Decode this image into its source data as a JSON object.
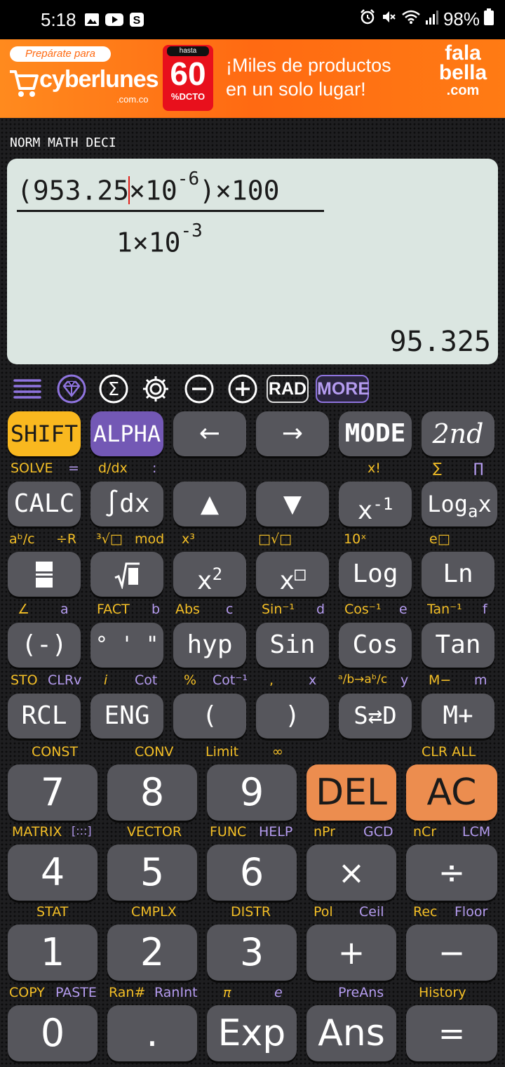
{
  "status_bar": {
    "time": "5:18",
    "battery": "98%"
  },
  "ad": {
    "prep": "Prepárate para",
    "brand": "cyberlunes",
    "brand_domain": ".com.co",
    "badge_top": "hasta",
    "badge_value": "60",
    "badge_sub": "%DCTO",
    "headline_1": "¡Miles de productos",
    "headline_2": "en un solo lugar!",
    "logo_1": "fala",
    "logo_2": "bella",
    "logo_3": ".com"
  },
  "mode_indicators": "NORM MATH DECI",
  "display": {
    "numerator_a": "(953.25",
    "numerator_b": "×10",
    "numerator_exp": "-6",
    "numerator_c": ")×100",
    "denominator_a": "1×10",
    "denominator_exp": "-3",
    "result": "95.325"
  },
  "toolbar": {
    "rad": "RAD",
    "more": "MORE"
  },
  "keys": {
    "shift": "SHIFT",
    "alpha": "ALPHA",
    "left": "←",
    "right": "→",
    "mode": "MODE",
    "second": "2nd",
    "calc": "CALC",
    "integral": "∫dx",
    "up": "▲",
    "down": "▼",
    "inverse_base": "x",
    "inverse_exp": "-1",
    "loga_base": "Log",
    "loga_sub": "a",
    "loga_x": "x",
    "log": "Log",
    "ln": "Ln",
    "x2_base": "x",
    "x2_exp": "2",
    "xbox_base": "x",
    "xbox_exp": "□",
    "neg": "(-)",
    "dms": "° ' \"",
    "hyp": "hyp",
    "sin": "Sin",
    "cos": "Cos",
    "tan": "Tan",
    "rcl": "RCL",
    "eng": "ENG",
    "lparen": "(",
    "rparen": ")",
    "sd": "S⇄D",
    "mplus": "M+",
    "seven": "7",
    "eight": "8",
    "nine": "9",
    "del": "DEL",
    "ac": "AC",
    "four": "4",
    "five": "5",
    "six": "6",
    "times": "×",
    "divide": "÷",
    "one": "1",
    "two": "2",
    "three": "3",
    "plus": "+",
    "minus": "−",
    "zero": "0",
    "dot": ".",
    "exp": "Exp",
    "ans": "Ans",
    "equals": "="
  },
  "labels": {
    "solve": "SOLVE",
    "eq": "=",
    "ddx": "d/dx",
    "colon": ":",
    "xfact": "x!",
    "sigma": "∑",
    "pi_product": "∏",
    "abc": "aᵇ/c",
    "divr": "÷R",
    "cuberoot": "³√□",
    "mod": "mod",
    "x3": "x³",
    "nroot": "□√□",
    "ten_x": "10ˣ",
    "e_x": "e□",
    "angle": "∠",
    "a": "a",
    "fact": "FACT",
    "b": "b",
    "abs": "Abs",
    "c": "c",
    "sin_inv": "Sin⁻¹",
    "d": "d",
    "cos_inv": "Cos⁻¹",
    "e": "e",
    "tan_inv": "Tan⁻¹",
    "f": "f",
    "sto": "STO",
    "clrv": "CLRv",
    "i": "i",
    "cot": "Cot",
    "percent": "%",
    "cot_inv": "Cot⁻¹",
    "comma": ",",
    "x": "x",
    "frac_conv": "ᵃ/b→aᵇ/c",
    "y": "y",
    "mminus": "M−",
    "m": "m",
    "const": "CONST",
    "conv": "CONV",
    "limit": "Limit",
    "infinity": "∞",
    "clr_all": "CLR ALL",
    "matrix": "MATRIX",
    "matrix_icon": "[:::]",
    "vector": "VECTOR",
    "func": "FUNC",
    "help": "HELP",
    "npr": "nPr",
    "gcd": "GCD",
    "ncr": "nCr",
    "lcm": "LCM",
    "stat": "STAT",
    "cmplx": "CMPLX",
    "distr": "DISTR",
    "pol": "Pol",
    "ceil": "Ceil",
    "rec": "Rec",
    "floor": "Floor",
    "copy": "COPY",
    "paste": "PASTE",
    "ran": "Ran#",
    "ranint": "RanInt",
    "pi": "π",
    "e_const": "e",
    "preans": "PreAns",
    "history": "History"
  },
  "colors": {
    "shift": "#f9b81f",
    "alpha": "#7358b5",
    "orange": "#ec8d4f",
    "key": "#56565c",
    "display": "#dbe6e1"
  }
}
